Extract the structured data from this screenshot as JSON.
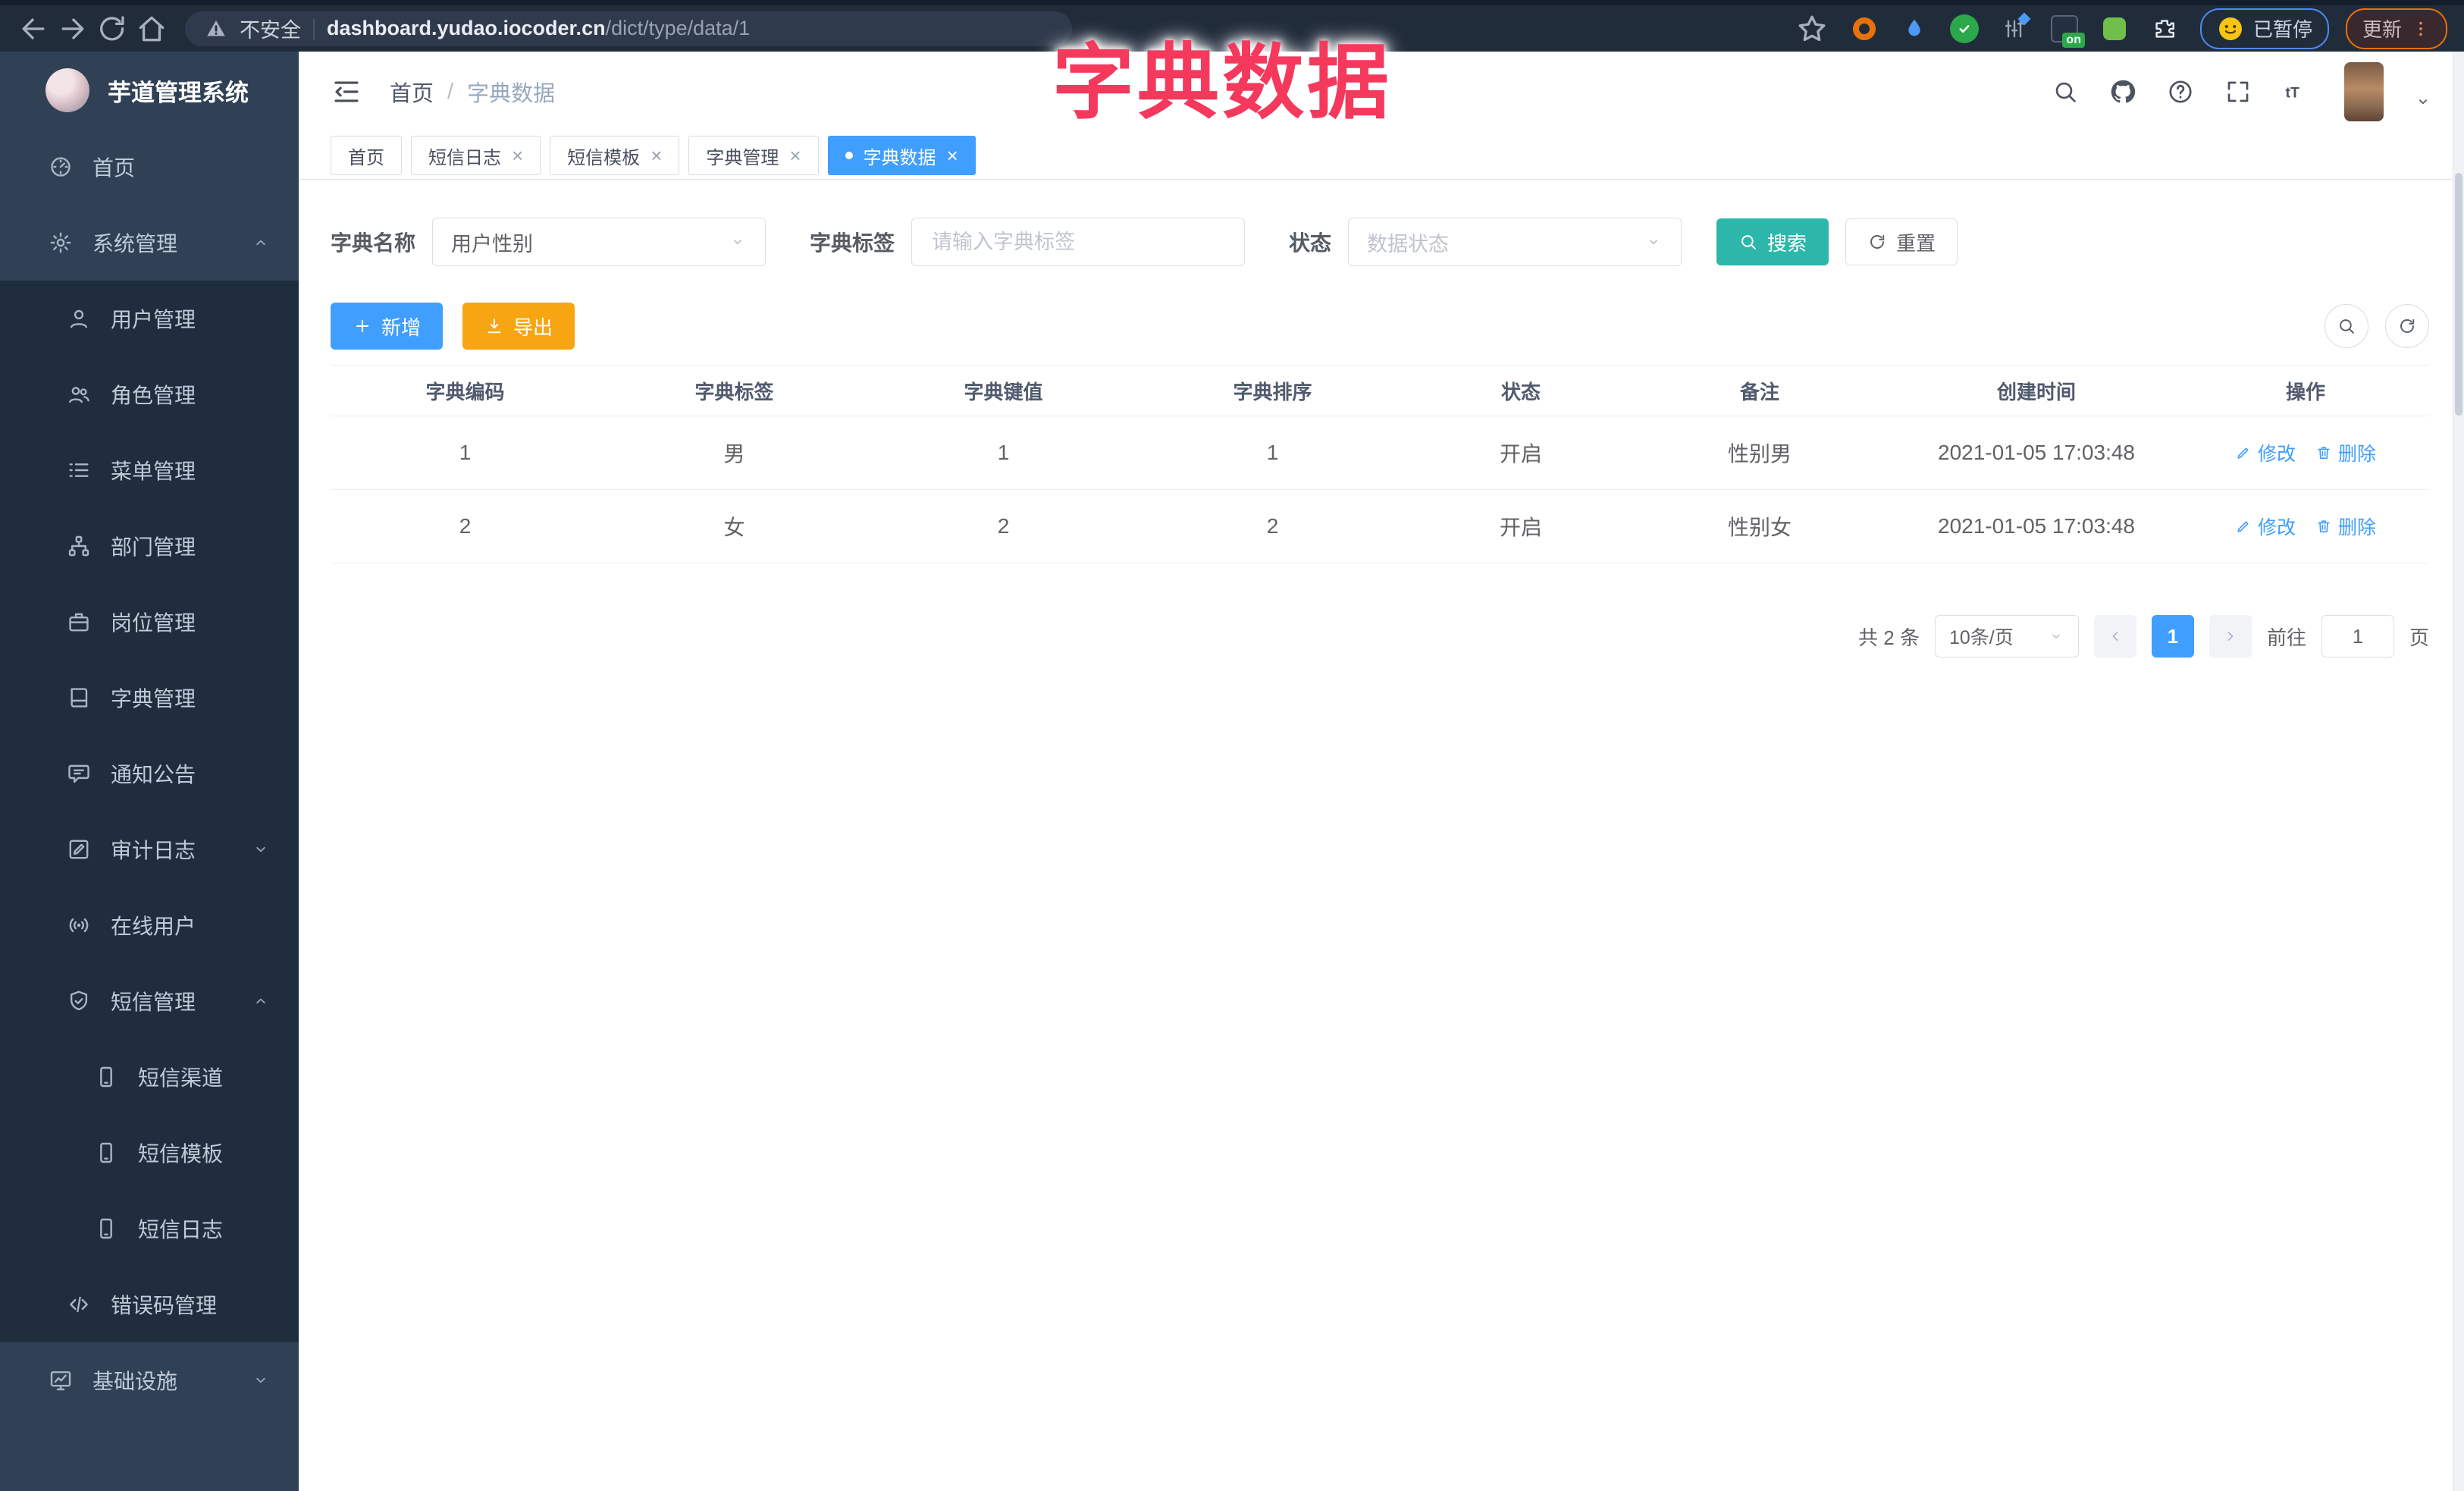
{
  "browser": {
    "security_label": "不安全",
    "url_domain": "dashboard.yudao.iocoder.cn",
    "url_path": "/dict/type/data/1",
    "paused_badge": "已暂停",
    "update_button": "更新",
    "extensions": [
      {
        "name": "orange-ring-extension-icon",
        "shape": "ring",
        "color": "#e8710a"
      },
      {
        "name": "blue-droplet-extension-icon",
        "shape": "droplet",
        "color": "#4a9af5"
      },
      {
        "name": "green-check-extension-icon",
        "shape": "check",
        "color": "#2aa84a"
      },
      {
        "name": "sliders-extension-icon",
        "shape": "sliders",
        "color": "#9aa6b7"
      },
      {
        "name": "on-badge-extension-icon",
        "shape": "onbadge",
        "color": "#23303f",
        "badge": "on"
      },
      {
        "name": "green-extension-icon",
        "shape": "dot",
        "color": "#6fbf4a"
      },
      {
        "name": "puzzle-extensions-icon",
        "shape": "puzzle",
        "color": "#e9edf2"
      }
    ]
  },
  "overlay_title": "字典数据",
  "sidebar": {
    "logo_title": "芋道管理系统",
    "top_items": [
      {
        "label": "首页",
        "icon": "home"
      },
      {
        "label": "系统管理",
        "icon": "gear",
        "arrow": "up"
      }
    ],
    "submenu_items": [
      {
        "label": "用户管理",
        "icon": "user",
        "level": 1
      },
      {
        "label": "角色管理",
        "icon": "users",
        "level": 1
      },
      {
        "label": "菜单管理",
        "icon": "menu",
        "level": 1
      },
      {
        "label": "部门管理",
        "icon": "tree",
        "level": 1
      },
      {
        "label": "岗位管理",
        "icon": "briefcase",
        "level": 1
      },
      {
        "label": "字典管理",
        "icon": "book",
        "level": 1
      },
      {
        "label": "通知公告",
        "icon": "message",
        "level": 1
      },
      {
        "label": "审计日志",
        "icon": "editdoc",
        "level": 1,
        "arrow": "down"
      },
      {
        "label": "在线用户",
        "icon": "online",
        "level": 1
      },
      {
        "label": "短信管理",
        "icon": "shield",
        "level": 1,
        "arrow": "up"
      },
      {
        "label": "短信渠道",
        "icon": "phone",
        "level": 2
      },
      {
        "label": "短信模板",
        "icon": "phone",
        "level": 2
      },
      {
        "label": "短信日志",
        "icon": "phone",
        "level": 2
      },
      {
        "label": "错误码管理",
        "icon": "code",
        "level": 1
      }
    ],
    "bottom_items": [
      {
        "label": "基础设施",
        "icon": "monitor",
        "arrow": "down"
      }
    ]
  },
  "header": {
    "breadcrumb": {
      "home": "首页",
      "separator": "/",
      "current": "字典数据"
    }
  },
  "tabs": [
    {
      "label": "首页",
      "closable": false,
      "active": false
    },
    {
      "label": "短信日志",
      "closable": true,
      "active": false
    },
    {
      "label": "短信模板",
      "closable": true,
      "active": false
    },
    {
      "label": "字典管理",
      "closable": true,
      "active": false
    },
    {
      "label": "字典数据",
      "closable": true,
      "active": true
    }
  ],
  "filters": {
    "dict_name_label": "字典名称",
    "dict_name_value": "用户性别",
    "dict_tag_label": "字典标签",
    "dict_tag_placeholder": "请输入字典标签",
    "status_label": "状态",
    "status_placeholder": "数据状态",
    "search_label": "搜索",
    "reset_label": "重置"
  },
  "toolbar": {
    "add_label": "新增",
    "export_label": "导出"
  },
  "table": {
    "columns": [
      "字典编码",
      "字典标签",
      "字典键值",
      "字典排序",
      "状态",
      "备注",
      "创建时间",
      "操作"
    ],
    "rows": [
      {
        "cells": [
          "1",
          "男",
          "1",
          "1",
          "开启",
          "性别男",
          "2021-01-05 17:03:48"
        ]
      },
      {
        "cells": [
          "2",
          "女",
          "2",
          "2",
          "开启",
          "性别女",
          "2021-01-05 17:03:48"
        ]
      }
    ],
    "row_actions": [
      {
        "label": "修改",
        "icon": "pen"
      },
      {
        "label": "删除",
        "icon": "trash"
      }
    ]
  },
  "pagination": {
    "total_text": "共 2 条",
    "page_size_value": "10条/页",
    "current_page": "1",
    "goto_label": "前往",
    "goto_value": "1",
    "page_unit_label": "页"
  },
  "colors": {
    "primary": "#409EFF",
    "search_teal": "#2db7ab",
    "export_orange": "#f7a512",
    "overlay_red": "#f4395d",
    "sidebar_bg": "#304156",
    "submenu_bg": "#1f2d3d"
  }
}
